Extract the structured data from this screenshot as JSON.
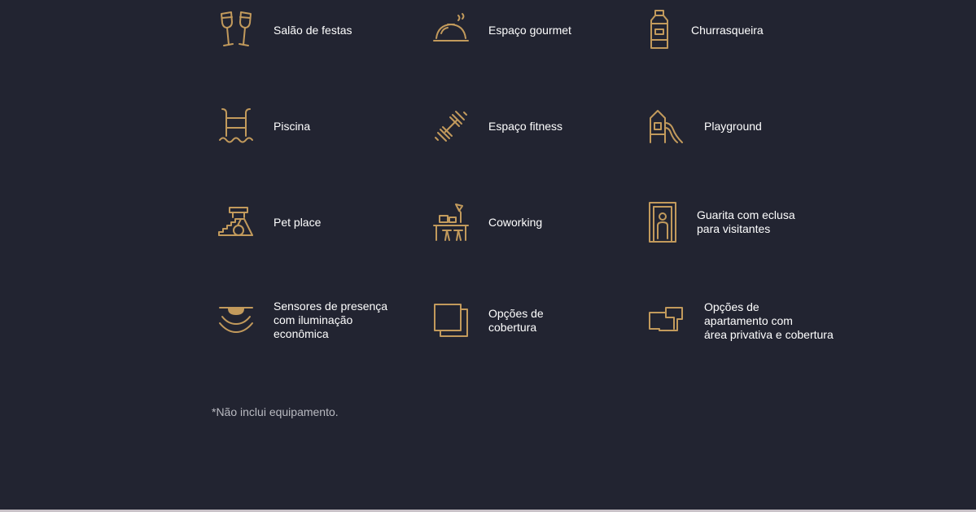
{
  "amenities": [
    {
      "label": "Salão de festas",
      "icon": "champagne-glasses-icon"
    },
    {
      "label": "Espaço gourmet",
      "icon": "cloche-icon"
    },
    {
      "label": "Churrasqueira",
      "icon": "bottle-icon"
    },
    {
      "label": "Piscina",
      "icon": "pool-ladder-icon"
    },
    {
      "label": "Espaço fitness",
      "icon": "dumbbell-icon"
    },
    {
      "label": "Playground",
      "icon": "slide-icon"
    },
    {
      "label": "Pet place",
      "icon": "pet-agility-icon"
    },
    {
      "label": "Coworking",
      "icon": "desk-lamp-icon"
    },
    {
      "label": "Guarita com eclusa\npara visitantes",
      "icon": "guardhouse-icon"
    },
    {
      "label": "Sensores de presença\ncom iluminação\neconômica",
      "icon": "presence-sensor-icon"
    },
    {
      "label": "Opções de\ncobertura",
      "icon": "penthouse-squares-icon"
    },
    {
      "label": "Opções de\napartamento com\nárea privativa e cobertura",
      "icon": "floorplan-icon"
    }
  ],
  "footnote": "*Não inclui equipamento.",
  "colors": {
    "background": "#222431",
    "icon": "#c29a5c",
    "text": "#ffffff",
    "footnote": "#b9bac1"
  }
}
